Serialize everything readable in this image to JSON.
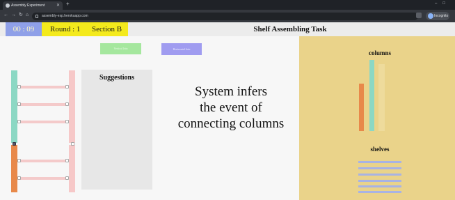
{
  "browser": {
    "tab_title": "Assembly Experiment",
    "url": "assembly-exp.herokuapp.com",
    "profile_label": "Incognito"
  },
  "header": {
    "timer": "00 : 09",
    "round": "Round : 1",
    "section": "Section B",
    "title": "Shelf Assembling Task"
  },
  "workspace": {
    "vertical_button": "Vertical Join",
    "horizontal_button": "Horizontal Join",
    "suggestions_title": "Suggestions",
    "caption_line1": "System infers",
    "caption_line2": "the event of",
    "caption_line3": "connecting columns"
  },
  "palette": {
    "columns_title": "columns",
    "shelves_title": "shelves"
  },
  "colors": {
    "timer_bg": "#8fa0e8",
    "round_bg": "#f4ea1c",
    "palette_bg": "#ead38a",
    "teal_column": "#8cd8c4",
    "orange_column": "#e8894a",
    "pink_column": "#f6c8c8",
    "shelf": "#a9b3e3"
  }
}
